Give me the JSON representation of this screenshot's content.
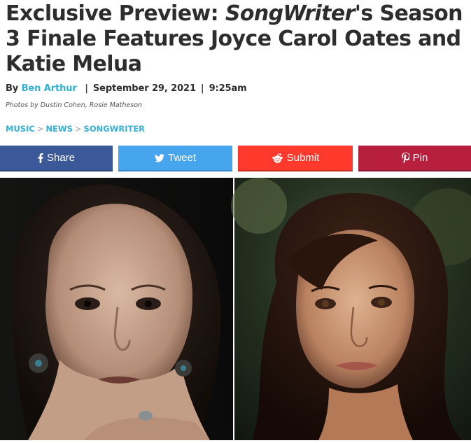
{
  "article": {
    "title_prefix": "Exclusive Preview: ",
    "title_italic": "SongWriter",
    "title_suffix": "'s Season 3 Finale Features Joyce Carol Oates and Katie Melua",
    "byline_prefix": "By",
    "author": "Ben Arthur",
    "date": "September 29, 2021",
    "time": "9:25am",
    "separator": "|",
    "photo_credit": "Photos by Dustin Cohen, Rosie Matheson"
  },
  "breadcrumbs": {
    "items": [
      "MUSIC",
      "NEWS",
      "SONGWRITER"
    ],
    "separator": ">"
  },
  "share": {
    "facebook": "Share",
    "twitter": "Tweet",
    "reddit": "Submit",
    "pinterest": "Pin",
    "colors": {
      "facebook": "#3b5998",
      "twitter": "#46a5ec",
      "reddit": "#ff3a2d",
      "pinterest": "#b81f3d"
    }
  },
  "hero": {
    "icons": [
      "facebook-icon",
      "twitter-icon",
      "reddit-icon",
      "pinterest-icon"
    ]
  }
}
